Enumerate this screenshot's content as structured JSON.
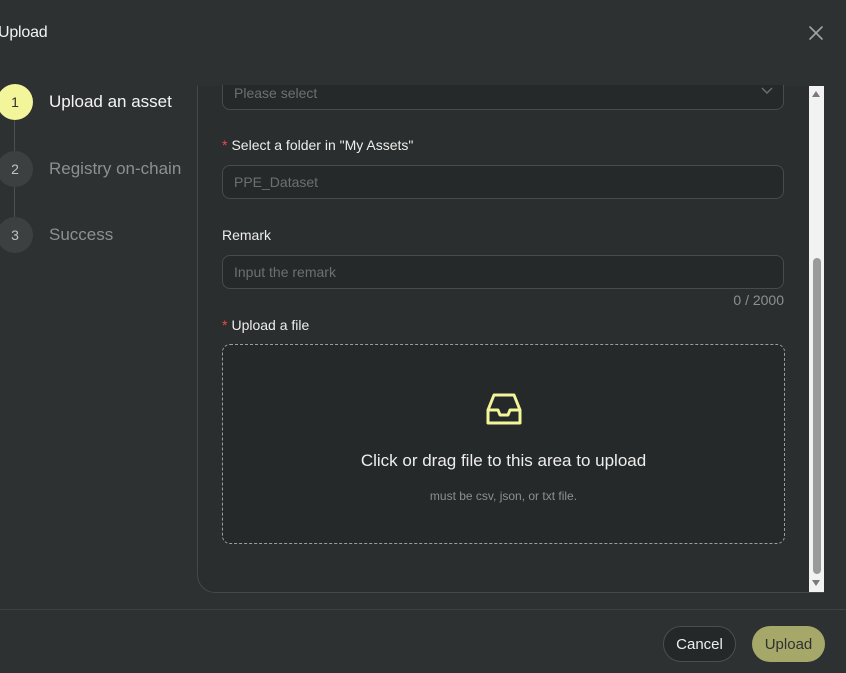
{
  "modal": {
    "title": "Upload",
    "close_icon": "close-icon"
  },
  "steps": [
    {
      "number": "1",
      "label": "Upload an asset",
      "state": "active"
    },
    {
      "number": "2",
      "label": "Registry on-chain",
      "state": "pending"
    },
    {
      "number": "3",
      "label": "Success",
      "state": "pending"
    }
  ],
  "form": {
    "type_select": {
      "placeholder": "Please select",
      "icon": "chevron-down-icon"
    },
    "folder": {
      "required_mark": "*",
      "label": "Select a folder in \"My Assets\"",
      "value": "PPE_Dataset"
    },
    "remark": {
      "label": "Remark",
      "placeholder": "Input the remark",
      "counter": "0 / 2000"
    },
    "file": {
      "required_mark": "*",
      "label": "Upload a file",
      "icon": "inbox-icon",
      "drop_text": "Click or drag file to this area to upload",
      "hint": "must be csv, json, or txt file."
    }
  },
  "footer": {
    "cancel_label": "Cancel",
    "upload_label": "Upload"
  },
  "colors": {
    "accent": "#f2f59a",
    "upload_button": "#a6a86a",
    "required": "#f04848",
    "background": "#2e3131"
  }
}
